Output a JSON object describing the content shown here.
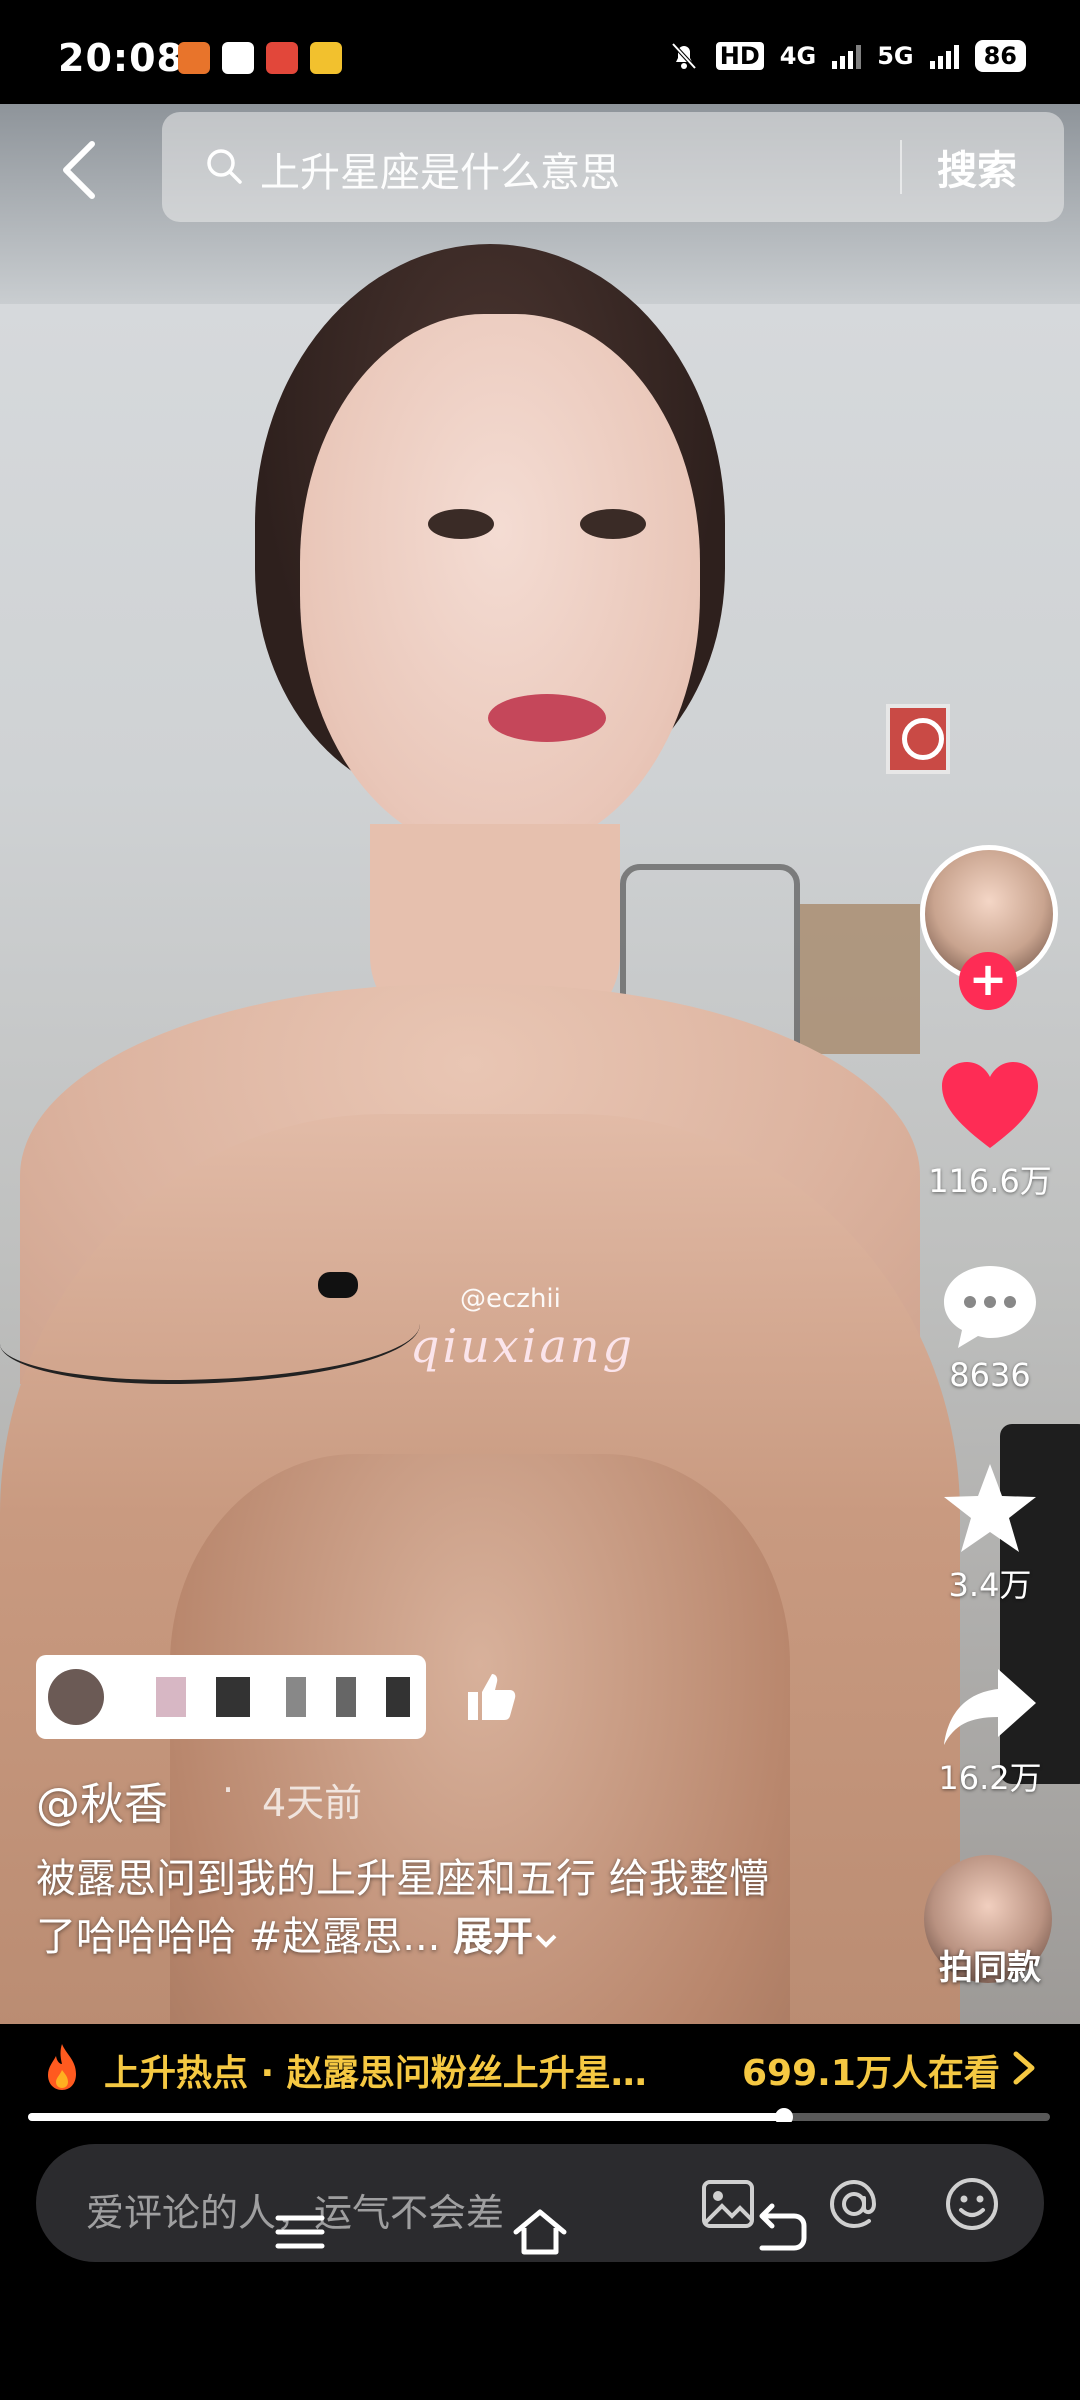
{
  "status_bar": {
    "time": "20:08",
    "network_hd": "HD",
    "net_4g": "4G",
    "net_5g": "5G",
    "battery": "86",
    "icons": [
      "app-icon-orange",
      "wifi-app-icon",
      "app-icon-red",
      "app-icon-yellow",
      "mute-bell-icon"
    ]
  },
  "search": {
    "query": "上升星座是什么意思",
    "button_label": "搜索"
  },
  "watermark": {
    "handle": "@eczhii",
    "script": "qiuxiang"
  },
  "actions": {
    "likes": "116.6万",
    "comments": "8636",
    "favorites": "3.4万",
    "shares": "16.2万",
    "similar_label": "拍同款"
  },
  "post": {
    "author": "@秋香",
    "time": "4天前",
    "caption": "被露思问到我的上升星座和五行 给我整懵了哈哈哈哈 #赵露思...",
    "expand_label": "展开"
  },
  "hot_bar": {
    "text": "上升热点 · 赵露思问粉丝上升星…",
    "viewers": "699.1万人在看"
  },
  "progress": {
    "value": 0.74
  },
  "comment": {
    "placeholder": "爱评论的人，运气不会差"
  },
  "colors": {
    "like": "#fe2c55",
    "hot_text": "#f5c842",
    "follow": "#fe2c55"
  }
}
